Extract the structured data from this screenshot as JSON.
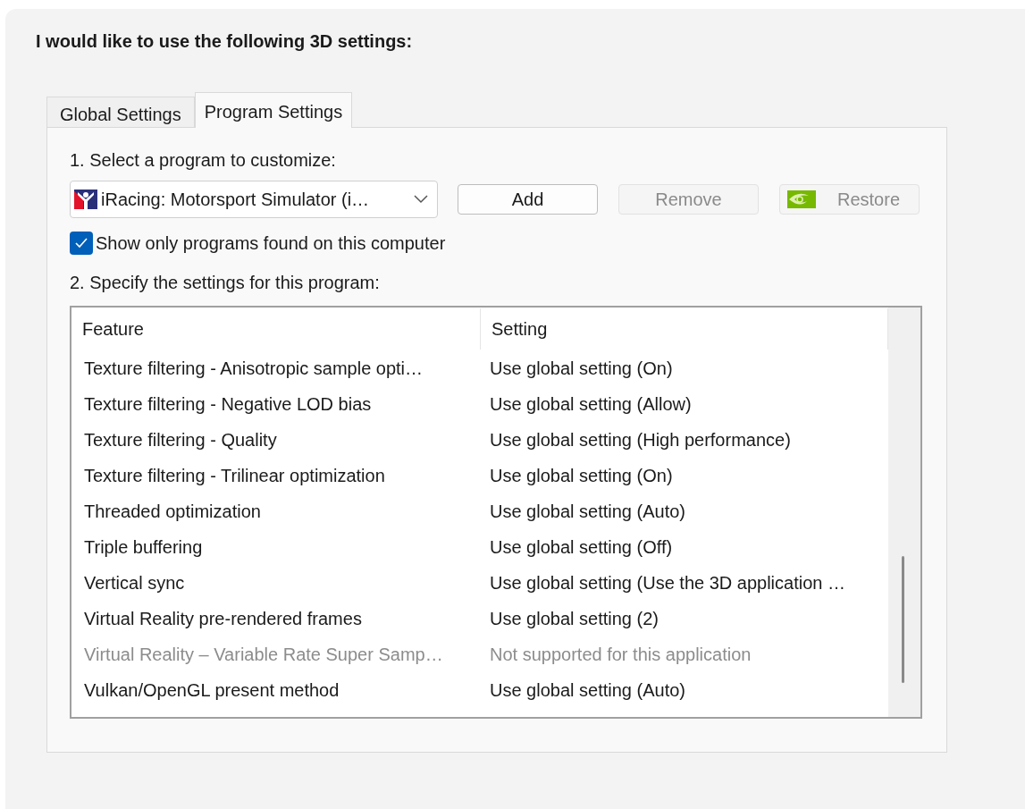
{
  "heading": "I would like to use the following 3D settings:",
  "tabs": [
    {
      "label": "Global Settings",
      "selected": false
    },
    {
      "label": "Program Settings",
      "selected": true
    }
  ],
  "program_section": {
    "label": "1. Select a program to customize:",
    "program": "iRacing: Motorsport Simulator (i…",
    "buttons": [
      {
        "label": "Add",
        "disabled": false,
        "kind": "plain"
      },
      {
        "label": "Remove",
        "disabled": true,
        "kind": "plain"
      },
      {
        "label": "Restore",
        "disabled": true,
        "kind": "logo"
      }
    ],
    "filter_checkbox": {
      "label": "Show only programs found on this computer",
      "checked": true
    }
  },
  "settings_section": {
    "label": "2. Specify the settings for this program:",
    "table": {
      "columns": [
        "Feature",
        "Setting"
      ],
      "rows": [
        {
          "feature": "Texture filtering - Anisotropic sample opti…",
          "setting": "Use global setting (On)",
          "disabled": false
        },
        {
          "feature": "Texture filtering - Negative LOD bias",
          "setting": "Use global setting (Allow)",
          "disabled": false
        },
        {
          "feature": "Texture filtering - Quality",
          "setting": "Use global setting (High performance)",
          "disabled": false
        },
        {
          "feature": "Texture filtering - Trilinear optimization",
          "setting": "Use global setting (On)",
          "disabled": false
        },
        {
          "feature": "Threaded optimization",
          "setting": "Use global setting (Auto)",
          "disabled": false
        },
        {
          "feature": "Triple buffering",
          "setting": "Use global setting (Off)",
          "disabled": false
        },
        {
          "feature": "Vertical sync",
          "setting": "Use global setting (Use the 3D application …",
          "disabled": false
        },
        {
          "feature": "Virtual Reality pre-rendered frames",
          "setting": "Use global setting (2)",
          "disabled": false
        },
        {
          "feature": "Virtual Reality – Variable Rate Super Samp…",
          "setting": "Not supported for this application",
          "disabled": true
        },
        {
          "feature": "Vulkan/OpenGL present method",
          "setting": "Use global setting (Auto)",
          "disabled": false
        }
      ]
    }
  }
}
